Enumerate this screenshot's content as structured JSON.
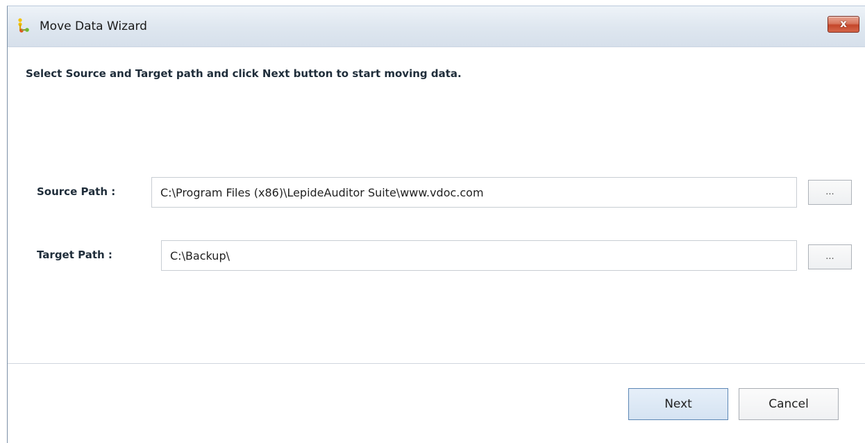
{
  "window": {
    "title": "Move Data Wizard",
    "close_label": "x"
  },
  "instruction": "Select Source and Target path and click  Next button to start moving data.",
  "source": {
    "label": "Source Path :",
    "value": "C:\\Program Files (x86)\\LepideAuditor Suite\\www.vdoc.com",
    "browse_label": "..."
  },
  "target": {
    "label": "Target Path :",
    "value": "C:\\Backup\\",
    "browse_label": "..."
  },
  "footer": {
    "next_label": "Next",
    "cancel_label": "Cancel"
  },
  "colors": {
    "titlebar": "#dfe7f0",
    "close_button": "#c4472b",
    "next_button_border": "#5b86b4",
    "label_text": "#1f2d3a"
  },
  "icons": {
    "app": "move-data-wizard-icon",
    "close": "close-icon"
  }
}
